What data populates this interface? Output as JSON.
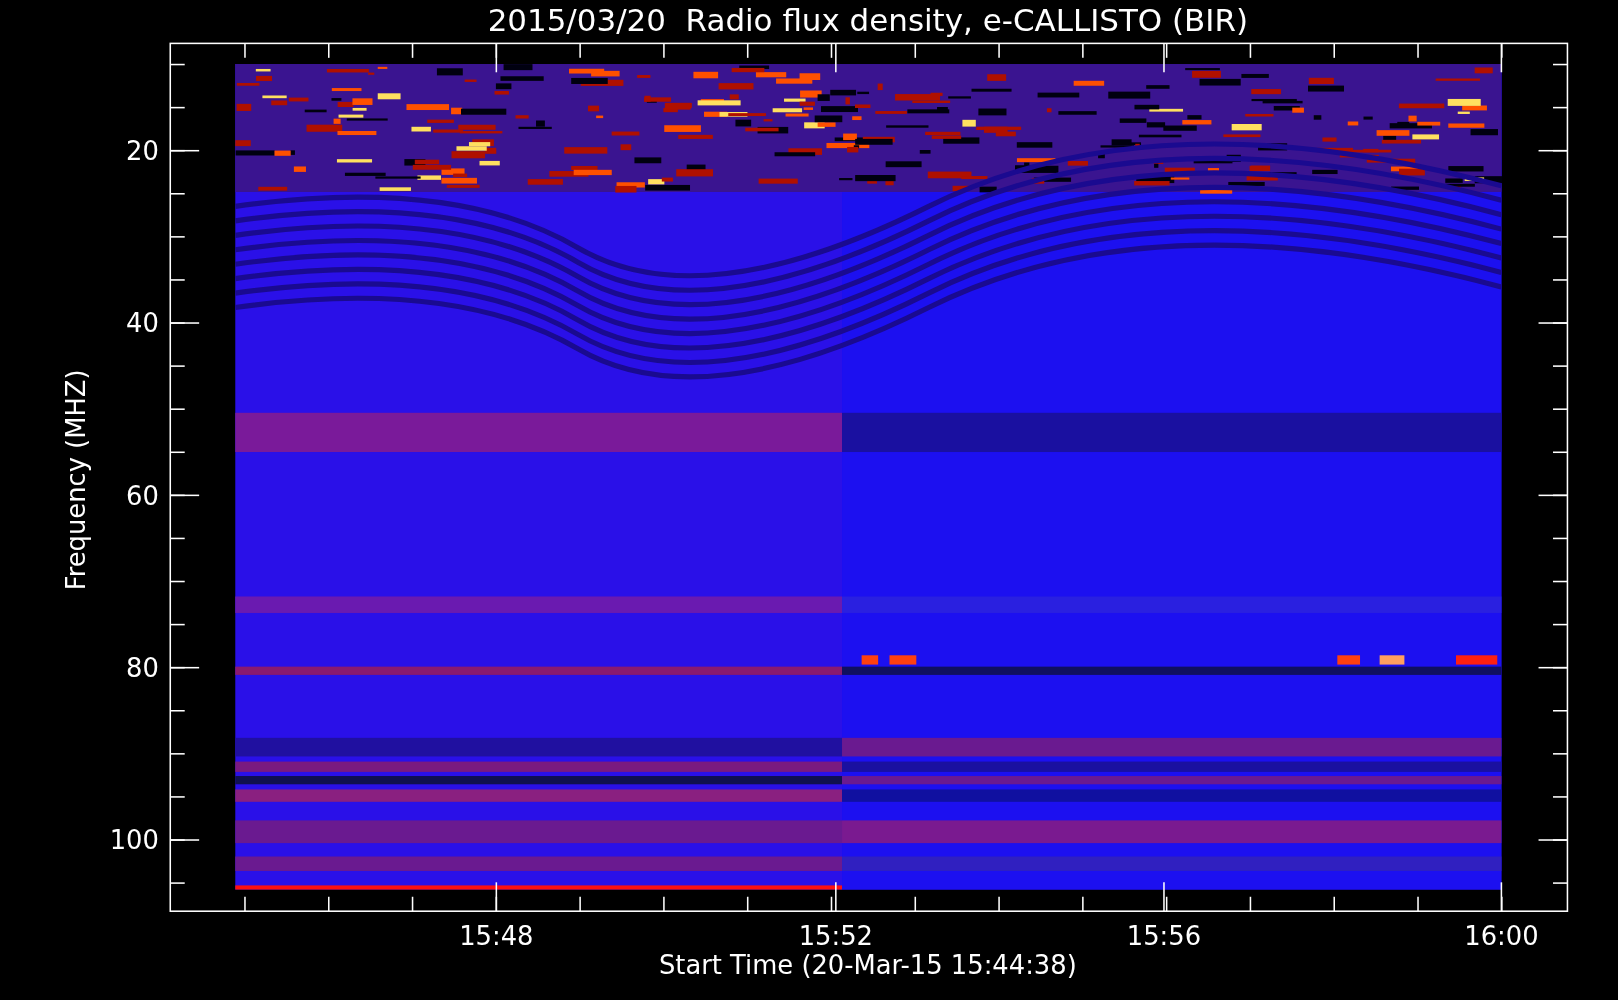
{
  "title": "2015/03/20  Radio flux density, e-CALLISTO (BIR)",
  "ylabel": "Frequency (MHZ)",
  "xlabel": "Start Time (20-Mar-15 15:44:38)",
  "yticks": [
    "20",
    "40",
    "60",
    "80",
    "100"
  ],
  "xticks": [
    "15:48",
    "15:52",
    "15:56",
    "16:00"
  ]
}
